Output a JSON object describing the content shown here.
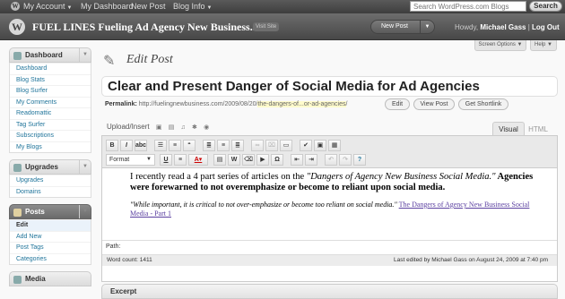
{
  "admin_bar": {
    "account": "My Account",
    "dashboard": "My Dashboard",
    "new_post": "New Post",
    "blog_info": "Blog Info",
    "search_placeholder": "Search WordPress.com Blogs",
    "search_button": "Search"
  },
  "header": {
    "site_title": "FUEL LINES Fueling Ad Agency New Business...",
    "visit_site": "Visit Site",
    "new_post_button": "New Post",
    "howdy_prefix": "Howdy,",
    "user_name": "Michael Gass",
    "separator": "|",
    "logout": "Log Out"
  },
  "screen_options": "Screen Options",
  "help": "Help",
  "sidebar": {
    "dashboard": {
      "label": "Dashboard",
      "items": [
        "Dashboard",
        "Blog Stats",
        "Blog Surfer",
        "My Comments",
        "Readomattic",
        "Tag Surfer",
        "Subscriptions",
        "My Blogs"
      ]
    },
    "upgrades": {
      "label": "Upgrades",
      "items": [
        "Upgrades",
        "Domains"
      ]
    },
    "posts": {
      "label": "Posts",
      "items": [
        "Edit",
        "Add New",
        "Post Tags",
        "Categories"
      ]
    },
    "media": {
      "label": "Media"
    }
  },
  "main": {
    "heading": "Edit Post",
    "post_title": "Clear and Present Danger of Social Media for Ad Agencies",
    "permalink": {
      "label": "Permalink:",
      "base": "http://fuelingnewbusiness.com/2009/08/20/",
      "slug": "the-dangers-of...or-ad-agencies",
      "trail": "/",
      "edit_button": "Edit",
      "view_button": "View Post",
      "shortlink_button": "Get Shortlink"
    },
    "upload_insert": "Upload/Insert",
    "tab_visual": "Visual",
    "tab_html": "HTML",
    "format_select": "Format",
    "content": {
      "p1_text": "I recently read a 4 part series of articles on the ",
      "p1_italic": "\"Dangers of Agency New Business Social Media.\"",
      "p1_bold": " Agencies were forewarned to not overemphasize or become to reliant upon social media.",
      "p2_quote": "\"While important, it is critical to not over-emphasize or become too reliant on social media.\"",
      "p2_link": "The Dangers of Agency New Business Social Media - Part 1"
    },
    "path_label": "Path:",
    "word_count": "Word count: 1411",
    "last_edited": "Last edited by Michael Gass on August 24, 2009 at 7:40 pm",
    "excerpt_label": "Excerpt"
  }
}
